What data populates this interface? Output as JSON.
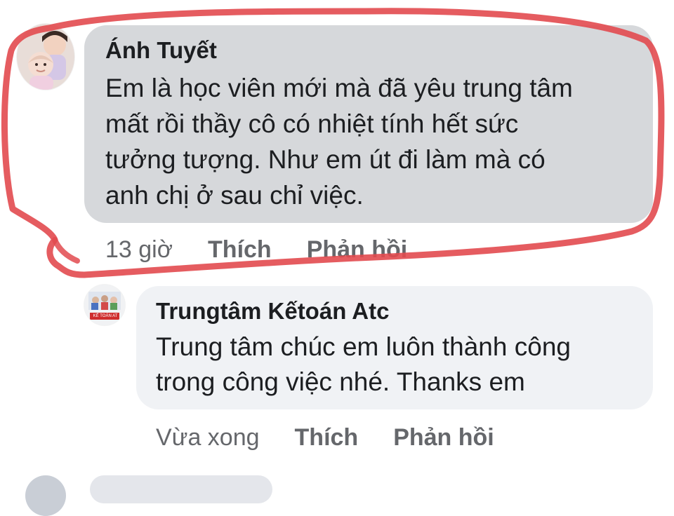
{
  "comments": [
    {
      "author": "Ánh Tuyết",
      "text": "Em là học viên mới mà đã yêu trung tâm\nmất rồi thầy cô có nhiệt tính hết sức\ntưởng tượng. Như em út đi làm mà có\nanh chị ở sau chỉ việc.",
      "time": "13 giờ",
      "like_label": "Thích",
      "reply_label": "Phản hồi",
      "bubble_color": "#d6d8db"
    },
    {
      "author": "Trungtâm Kếtoán Atc",
      "text": "Trung tâm chúc em luôn thành công\ntrong công việc nhé. Thanks em",
      "time": "Vừa xong",
      "like_label": "Thích",
      "reply_label": "Phản hồi",
      "bubble_color": "#f0f2f5",
      "avatar_caption": "KẾ TOÁN AT"
    }
  ],
  "annotation": {
    "color": "#e24a4f"
  },
  "colors": {
    "secondary_text": "#65676b",
    "primary_text": "#1c1e21"
  }
}
